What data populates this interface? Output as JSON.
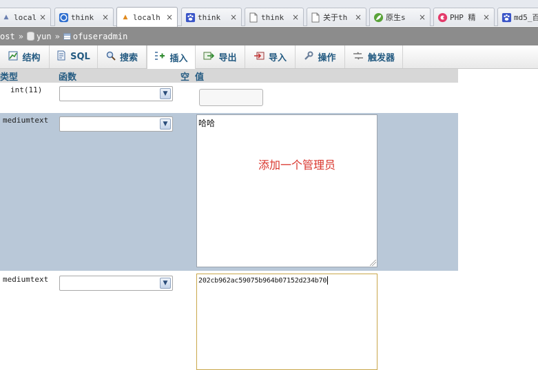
{
  "browser": {
    "tabs": [
      {
        "label": "localh",
        "icon": "pma-icon"
      },
      {
        "label": "think",
        "icon": "globe-icon"
      },
      {
        "label": "localh",
        "icon": "pma-icon",
        "active": true
      },
      {
        "label": "think",
        "icon": "paw-icon"
      },
      {
        "label": "think",
        "icon": "page-icon"
      },
      {
        "label": "关于th",
        "icon": "page-icon"
      },
      {
        "label": "原生s",
        "icon": "leaf-icon"
      },
      {
        "label": "PHP 精",
        "icon": "red-c-icon"
      },
      {
        "label": "md5_百",
        "icon": "paw-icon"
      }
    ],
    "close_glyph": "×"
  },
  "breadcrumb": {
    "host": "ost",
    "separator": "»",
    "database": "yun",
    "table": "ofuseradmin"
  },
  "toolbar": {
    "items": [
      {
        "label": "结构",
        "icon": "structure-icon"
      },
      {
        "label": "SQL",
        "icon": "sql-icon"
      },
      {
        "label": "搜索",
        "icon": "search-icon"
      },
      {
        "label": "插入",
        "icon": "insert-icon",
        "active": true
      },
      {
        "label": "导出",
        "icon": "export-icon"
      },
      {
        "label": "导入",
        "icon": "import-icon"
      },
      {
        "label": "操作",
        "icon": "wrench-icon"
      },
      {
        "label": "触发器",
        "icon": "trigger-icon"
      }
    ]
  },
  "grid": {
    "headers": {
      "type": "类型",
      "function": "函数",
      "null": "空",
      "value": "值"
    },
    "rows": [
      {
        "type": "int(11)",
        "function": "",
        "value": ""
      },
      {
        "type": "mediumtext",
        "function": "",
        "value": "哈哈"
      },
      {
        "type": "mediumtext",
        "function": "",
        "value": "202cb962ac59075b964b07152d234b70"
      }
    ]
  },
  "annotation": {
    "text": "添加一个管理员",
    "color": "#d9342b"
  },
  "colors": {
    "accent": "#235a81",
    "row_highlight": "#b9c8d8",
    "breadcrumb_bg": "#8c8c8c"
  }
}
